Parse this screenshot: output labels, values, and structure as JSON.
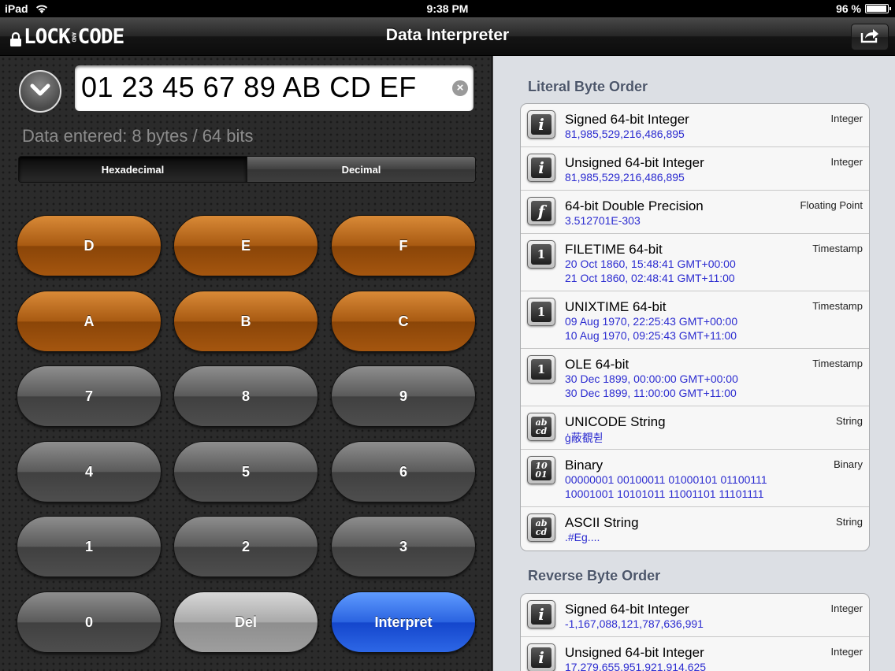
{
  "status": {
    "device": "iPad",
    "time": "9:38 PM",
    "battery": "96 %",
    "battery_level": 0.96
  },
  "nav": {
    "logo_left": "LOCK",
    "logo_small": "AND",
    "logo_right": "CODE",
    "title": "Data Interpreter",
    "share_icon": "share-icon"
  },
  "input": {
    "value": "01 23 45 67 89 AB CD EF",
    "clear_icon": "clear-icon"
  },
  "data_entered": "Data entered: 8 bytes / 64 bits",
  "segment": {
    "hex": "Hexadecimal",
    "dec": "Decimal",
    "selected": "Hexadecimal"
  },
  "keys": {
    "d": "D",
    "e": "E",
    "f": "F",
    "a": "A",
    "b": "B",
    "c": "C",
    "k7": "7",
    "k8": "8",
    "k9": "9",
    "k4": "4",
    "k5": "5",
    "k6": "6",
    "k1": "1",
    "k2": "2",
    "k3": "3",
    "k0": "0",
    "del": "Del",
    "interpret": "Interpret"
  },
  "literal": {
    "header": "Literal Byte Order",
    "rows": [
      {
        "icon": "integer-icon",
        "glyph": "i",
        "name": "Signed 64-bit Integer",
        "type": "Integer",
        "v1": "81,985,529,216,486,895",
        "v2": ""
      },
      {
        "icon": "integer-icon",
        "glyph": "i",
        "name": "Unsigned 64-bit Integer",
        "type": "Integer",
        "v1": "81,985,529,216,486,895",
        "v2": ""
      },
      {
        "icon": "float-icon",
        "glyph": "f",
        "name": "64-bit Double Precision",
        "type": "Floating Point",
        "v1": "3.512701E-303",
        "v2": ""
      },
      {
        "icon": "calendar-icon",
        "glyph": "1",
        "name": "FILETIME 64-bit",
        "type": "Timestamp",
        "v1": "20 Oct 1860, 15:48:41 GMT+00:00",
        "v2": "21 Oct 1860, 02:48:41 GMT+11:00"
      },
      {
        "icon": "calendar-icon",
        "glyph": "1",
        "name": "UNIXTIME 64-bit",
        "type": "Timestamp",
        "v1": "09 Aug 1970, 22:25:43 GMT+00:00",
        "v2": "10 Aug 1970, 09:25:43 GMT+11:00"
      },
      {
        "icon": "calendar-icon",
        "glyph": "1",
        "name": "OLE 64-bit",
        "type": "Timestamp",
        "v1": "30 Dec 1899, 00:00:00 GMT+00:00",
        "v2": "30 Dec 1899, 11:00:00 GMT+11:00"
      },
      {
        "icon": "string-icon",
        "glyph": "ab cd",
        "name": "UNICODE String",
        "type": "String",
        "v1": "ģ蔽覩췯",
        "v2": ""
      },
      {
        "icon": "binary-icon",
        "glyph": "10 01",
        "name": "Binary",
        "type": "Binary",
        "v1": "00000001 00100011 01000101 01100111",
        "v2": "10001001 10101011 11001101 11101111"
      },
      {
        "icon": "string-icon",
        "glyph": "ab cd",
        "name": "ASCII String",
        "type": "String",
        "v1": ".#Eg....",
        "v2": ""
      }
    ]
  },
  "reverse": {
    "header": "Reverse Byte Order",
    "rows": [
      {
        "icon": "integer-icon",
        "glyph": "i",
        "name": "Signed 64-bit Integer",
        "type": "Integer",
        "v1": "-1,167,088,121,787,636,991",
        "v2": ""
      },
      {
        "icon": "integer-icon",
        "glyph": "i",
        "name": "Unsigned 64-bit Integer",
        "type": "Integer",
        "v1": "17,279,655,951,921,914,625",
        "v2": ""
      }
    ]
  }
}
